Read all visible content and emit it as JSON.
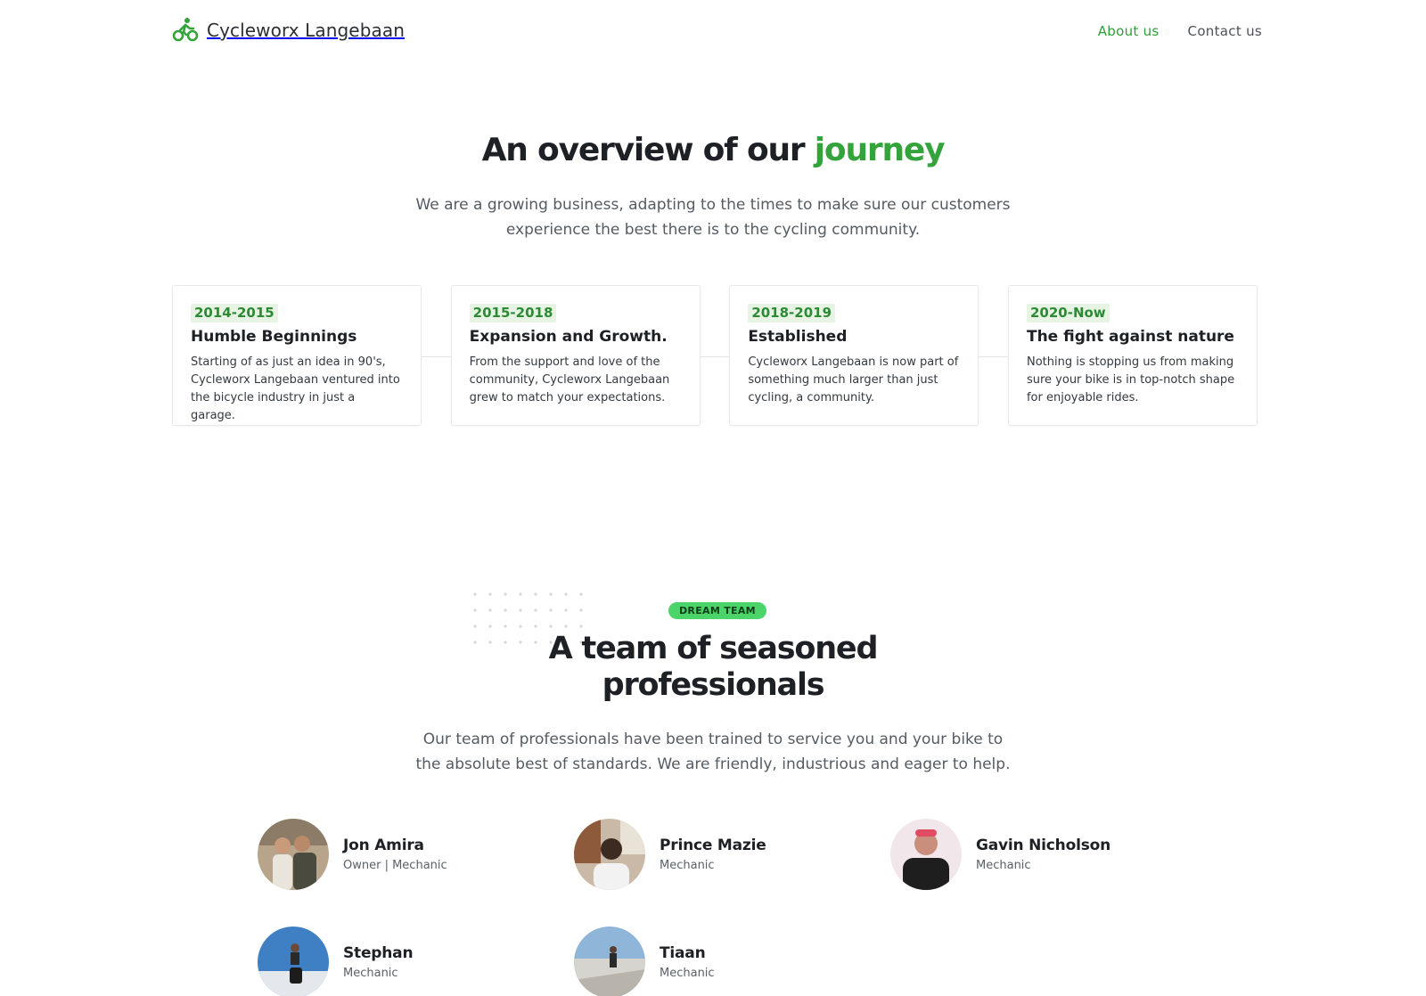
{
  "header": {
    "brand_name": "Cycleworx Langebaan",
    "brand_icon": "cyclist-icon",
    "nav": [
      {
        "label": "About us",
        "active": true
      },
      {
        "label": "Contact us",
        "active": false
      }
    ]
  },
  "journey": {
    "title_main": "An overview of our ",
    "title_accent": "journey",
    "subtitle": "We are a growing business, adapting to the times to make sure our customers experience the best there is to the cycling community.",
    "cards": [
      {
        "year": "2014-2015",
        "title": "Humble Beginnings",
        "text": "Starting of as just an idea in 90's, Cycleworx Langebaan ventured into the bicycle industry in just a garage."
      },
      {
        "year": "2015-2018",
        "title": "Expansion and Growth.",
        "text": "From the support and love of the community, Cycleworx Langebaan grew to match your expectations."
      },
      {
        "year": "2018-2019",
        "title": "Established",
        "text": "Cycleworx Langebaan is now part of something much larger than just cycling, a community."
      },
      {
        "year": "2020-Now",
        "title": "The fight against nature",
        "text": "Nothing is stopping us from making sure your bike is in top-notch shape for enjoyable rides."
      }
    ]
  },
  "team": {
    "badge": "DREAM TEAM",
    "title": "A team of seasoned professionals",
    "subtitle": "Our team of professionals have been trained to service you and your bike to the absolute best of standards. We are friendly, industrious and eager to help.",
    "members": [
      {
        "name": "Jon Amira",
        "role": "Owner | Mechanic"
      },
      {
        "name": "Prince Mazie",
        "role": "Mechanic"
      },
      {
        "name": "Gavin Nicholson",
        "role": "Mechanic"
      },
      {
        "name": "Stephan",
        "role": "Mechanic"
      },
      {
        "name": "Tiaan",
        "role": "Mechanic"
      }
    ]
  },
  "colors": {
    "accent": "#34a33c",
    "badge_bg": "#4bd46a",
    "year_bg": "#e7f4e4"
  }
}
